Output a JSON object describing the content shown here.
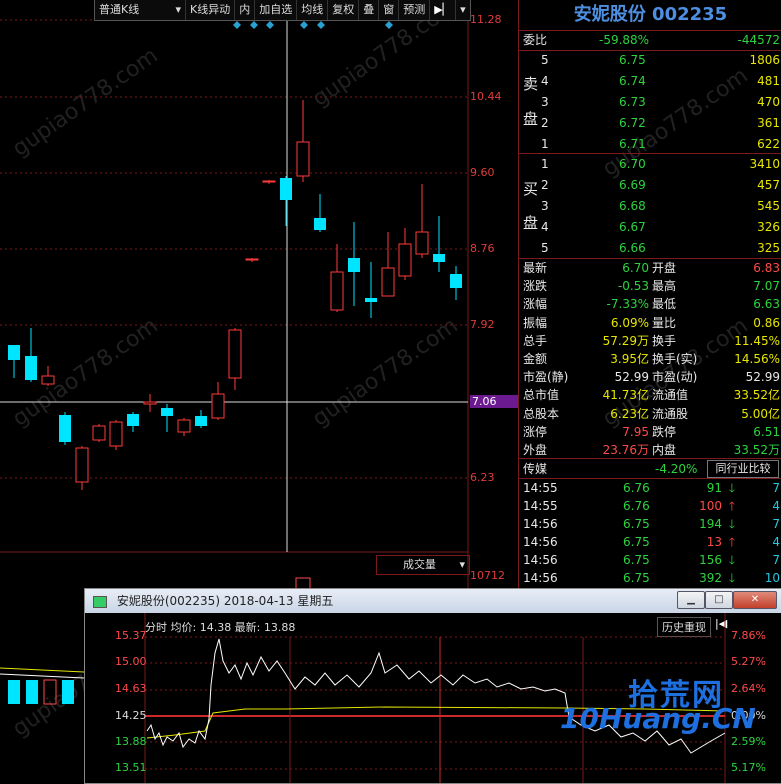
{
  "toolbar": {
    "items": [
      "普通K线",
      "K线异动",
      "内",
      "加自选",
      "均线",
      "复权",
      "叠",
      "窗",
      "预测"
    ],
    "kline_dropdown": "普通K线",
    "arrow_icon": "▾",
    "next_icon": "◀▶"
  },
  "price_axis": {
    "labels": [
      "11.28",
      "10.44",
      "9.60",
      "8.76",
      "7.92",
      "7.06",
      "6.23"
    ],
    "highlight": "7.06"
  },
  "volume": {
    "label": "成交量",
    "value": "10712"
  },
  "stock": {
    "title": "安妮股份 002235"
  },
  "weibi": {
    "label": "委比",
    "pct": "-59.88%",
    "diff": "-44572"
  },
  "sell_label": [
    "卖",
    "盘"
  ],
  "buy_label": [
    "买",
    "盘"
  ],
  "sell": [
    {
      "lvl": "5",
      "price": "6.75",
      "vol": "1806"
    },
    {
      "lvl": "4",
      "price": "6.74",
      "vol": "481"
    },
    {
      "lvl": "3",
      "price": "6.73",
      "vol": "470"
    },
    {
      "lvl": "2",
      "price": "6.72",
      "vol": "361"
    },
    {
      "lvl": "1",
      "price": "6.71",
      "vol": "622"
    }
  ],
  "buy": [
    {
      "lvl": "1",
      "price": "6.70",
      "vol": "3410"
    },
    {
      "lvl": "2",
      "price": "6.69",
      "vol": "457"
    },
    {
      "lvl": "3",
      "price": "6.68",
      "vol": "545"
    },
    {
      "lvl": "4",
      "price": "6.67",
      "vol": "326"
    },
    {
      "lvl": "5",
      "price": "6.66",
      "vol": "325"
    }
  ],
  "stats": [
    {
      "l1": "最新",
      "v1": "6.70",
      "c1": "green",
      "l2": "开盘",
      "v2": "6.83",
      "c2": "red"
    },
    {
      "l1": "涨跌",
      "v1": "-0.53",
      "c1": "green",
      "l2": "最高",
      "v2": "7.07",
      "c2": "green"
    },
    {
      "l1": "涨幅",
      "v1": "-7.33%",
      "c1": "green",
      "l2": "最低",
      "v2": "6.63",
      "c2": "green"
    },
    {
      "l1": "振幅",
      "v1": "6.09%",
      "c1": "yellow",
      "l2": "量比",
      "v2": "0.86",
      "c2": "yellow"
    },
    {
      "l1": "总手",
      "v1": "57.29万",
      "c1": "yellow",
      "l2": "换手",
      "v2": "11.45%",
      "c2": "yellow"
    },
    {
      "l1": "金额",
      "v1": "3.95亿",
      "c1": "yellow",
      "l2": "换手(实)",
      "v2": "14.56%",
      "c2": "yellow"
    },
    {
      "l1": "市盈(静)",
      "v1": "52.99",
      "c1": "white",
      "l2": "市盈(动)",
      "v2": "52.99",
      "c2": "white"
    },
    {
      "l1": "总市值",
      "v1": "41.73亿",
      "c1": "yellow",
      "l2": "流通值",
      "v2": "33.52亿",
      "c2": "yellow"
    },
    {
      "l1": "总股本",
      "v1": "6.23亿",
      "c1": "yellow",
      "l2": "流通股",
      "v2": "5.00亿",
      "c2": "yellow"
    },
    {
      "l1": "涨停",
      "v1": "7.95",
      "c1": "red",
      "l2": "跌停",
      "v2": "6.51",
      "c2": "green"
    },
    {
      "l1": "外盘",
      "v1": "23.76万",
      "c1": "red",
      "l2": "内盘",
      "v2": "33.52万",
      "c2": "green"
    }
  ],
  "sector": {
    "name": "传媒",
    "pct": "-4.20%",
    "button": "同行业比较"
  },
  "ticks": [
    {
      "t": "14:55",
      "p": "6.76",
      "v": "91",
      "dir": "down",
      "n": "7"
    },
    {
      "t": "14:55",
      "p": "6.76",
      "v": "100",
      "dir": "up",
      "n": "4"
    },
    {
      "t": "14:56",
      "p": "6.75",
      "v": "194",
      "dir": "down",
      "n": "7"
    },
    {
      "t": "14:56",
      "p": "6.75",
      "v": "13",
      "dir": "up",
      "n": "4"
    },
    {
      "t": "14:56",
      "p": "6.75",
      "v": "156",
      "dir": "down",
      "n": "7"
    },
    {
      "t": "14:56",
      "p": "6.75",
      "v": "392",
      "dir": "down",
      "n": "10"
    }
  ],
  "popup": {
    "title": "安妮股份(002235) 2018-04-13 星期五",
    "header": "分时 均价: 14.38 最新: 13.88",
    "history_btn": "历史重现",
    "left_axis": [
      "15.37",
      "15.00",
      "14.63",
      "14.25",
      "13.88",
      "13.51"
    ],
    "right_axis": [
      "7.86%",
      "5.27%",
      "2.64%",
      "0.00%",
      "2.59%",
      "5.17%"
    ],
    "min_icon": "▁",
    "max_icon": "□",
    "close_icon": "✕"
  },
  "logo": {
    "top": "拾荒网",
    "bottom": "10Huang.CN"
  },
  "watermark": "gupiao778.com"
}
